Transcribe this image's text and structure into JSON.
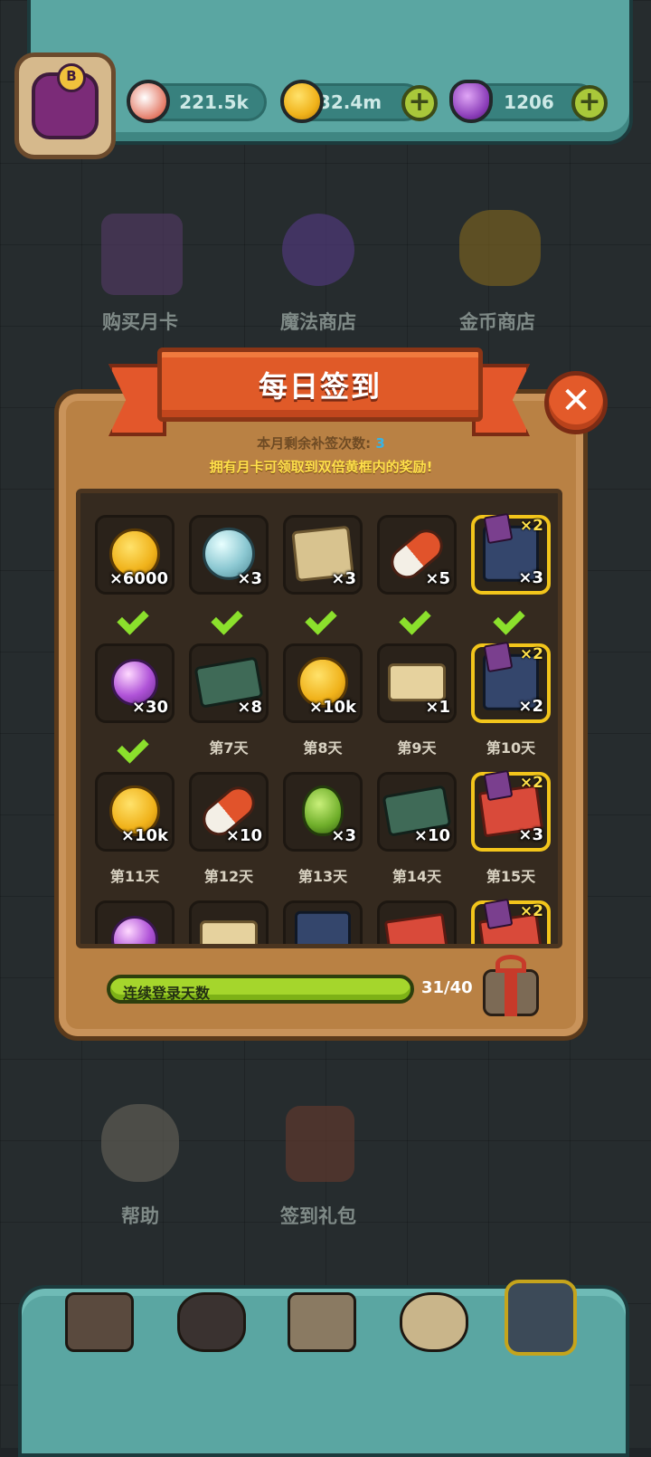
{
  "resources": [
    {
      "icon": "eyeball-icon",
      "value": "221.5k"
    },
    {
      "icon": "coin-icon",
      "value": "32.4m"
    },
    {
      "icon": "potion-icon",
      "value": "1206"
    }
  ],
  "menu": {
    "buy_monthly_card": "购买月卡",
    "magic_shop": "魔法商店",
    "gold_shop": "金币商店",
    "help": "帮助",
    "signin_gift": "签到礼包"
  },
  "modal": {
    "title": "每日签到",
    "remaining_label": "本月剩余补签次数:",
    "remaining_value": "3",
    "tip": "拥有月卡可领取到双倍黄框内的奖励!",
    "progress_label": "连续登录天数",
    "progress_value": "31/40",
    "progress_fraction": 0.775,
    "double_badge": "×2",
    "close_glyph": "✕"
  },
  "rewards": [
    {
      "icon": "gold-coin-icon",
      "qty": "×6000",
      "claimed": true,
      "day": ""
    },
    {
      "icon": "crystal-orb-icon",
      "qty": "×3",
      "claimed": true,
      "day": ""
    },
    {
      "icon": "treasure-map-icon",
      "qty": "×3",
      "claimed": true,
      "day": ""
    },
    {
      "icon": "capsule-icon",
      "qty": "×5",
      "claimed": true,
      "day": ""
    },
    {
      "icon": "card-pack-icon",
      "qty": "×3",
      "claimed": true,
      "day": "",
      "double": true
    },
    {
      "icon": "purple-potion-icon",
      "qty": "×30",
      "claimed": true,
      "day": ""
    },
    {
      "icon": "ticket-icon",
      "qty": "×8",
      "claimed": false,
      "day": "第7天"
    },
    {
      "icon": "gold-coin-icon",
      "qty": "×10k",
      "claimed": false,
      "day": "第8天"
    },
    {
      "icon": "scroll-icon",
      "qty": "×1",
      "claimed": false,
      "day": "第9天"
    },
    {
      "icon": "card-pack-icon",
      "qty": "×2",
      "claimed": false,
      "day": "第10天",
      "double": true
    },
    {
      "icon": "gold-coin-icon",
      "qty": "×10k",
      "claimed": false,
      "day": "第11天"
    },
    {
      "icon": "capsule-icon",
      "qty": "×10",
      "claimed": false,
      "day": "第12天"
    },
    {
      "icon": "green-egg-icon",
      "qty": "×3",
      "claimed": false,
      "day": "第13天"
    },
    {
      "icon": "ticket-icon",
      "qty": "×10",
      "claimed": false,
      "day": "第14天"
    },
    {
      "icon": "rug-icon",
      "qty": "×3",
      "claimed": false,
      "day": "第15天",
      "double": true
    },
    {
      "icon": "purple-potion-icon",
      "qty": "",
      "claimed": false,
      "day": ""
    },
    {
      "icon": "herb-icon",
      "qty": "",
      "claimed": false,
      "day": ""
    },
    {
      "icon": "card-pack-icon",
      "qty": "",
      "claimed": false,
      "day": ""
    },
    {
      "icon": "rug-icon",
      "qty": "",
      "claimed": false,
      "day": ""
    },
    {
      "icon": "chest-icon",
      "qty": "",
      "claimed": false,
      "day": "",
      "double": true
    }
  ],
  "colors": {
    "accent_gold": "#f2c51b",
    "check_green": "#8be02c",
    "ribbon": "#e05a28"
  }
}
